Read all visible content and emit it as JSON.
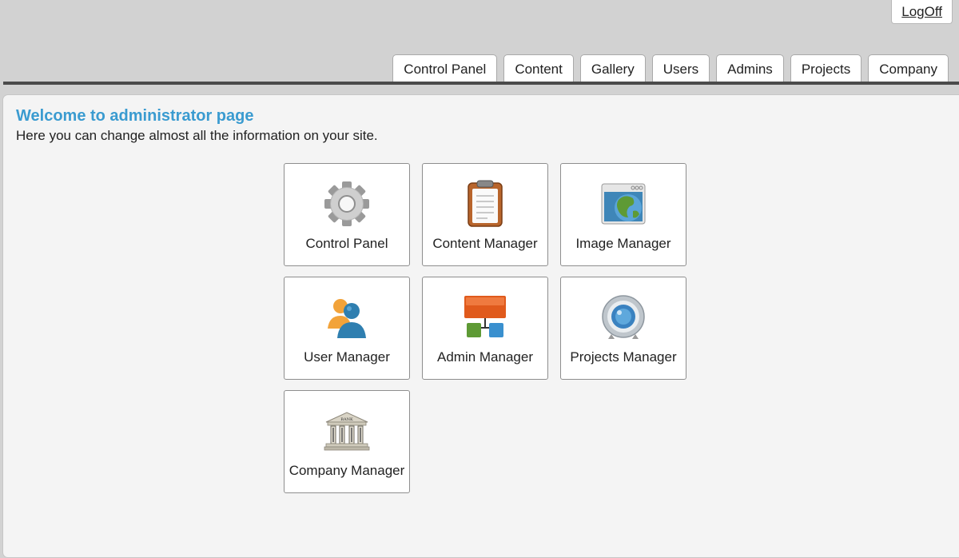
{
  "header": {
    "logoff_label": "LogOff",
    "tabs": [
      {
        "label": "Control Panel"
      },
      {
        "label": "Content"
      },
      {
        "label": "Gallery"
      },
      {
        "label": "Users"
      },
      {
        "label": "Admins"
      },
      {
        "label": "Projects"
      },
      {
        "label": "Company"
      }
    ]
  },
  "main": {
    "title": "Welcome to administrator page",
    "subtitle": "Here you can change almost all the information on your site.",
    "tiles": [
      {
        "label": "Control Panel",
        "icon": "gear-icon"
      },
      {
        "label": "Content Manager",
        "icon": "clipboard-icon"
      },
      {
        "label": "Image Manager",
        "icon": "globe-window-icon"
      },
      {
        "label": "User Manager",
        "icon": "users-icon"
      },
      {
        "label": "Admin Manager",
        "icon": "hierarchy-icon"
      },
      {
        "label": "Projects Manager",
        "icon": "webcam-icon"
      },
      {
        "label": "Company Manager",
        "icon": "bank-icon",
        "icon_text": "BANK"
      }
    ]
  },
  "colors": {
    "title": "#3a9bd0",
    "background": "#d2d2d2",
    "panel": "#f4f4f4"
  }
}
